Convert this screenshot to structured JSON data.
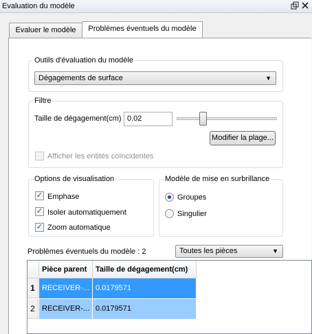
{
  "window": {
    "title": "Evaluation du modèle",
    "icons": [
      "restore-icon",
      "close-icon"
    ]
  },
  "tabs": [
    {
      "label": "Evaluer le modèle",
      "active": false
    },
    {
      "label": "Problèmes éventuels du modèle",
      "active": true
    }
  ],
  "tools": {
    "group_title": "Outils d'évaluation du modèle",
    "selected": "Dégagements de surface"
  },
  "filter": {
    "group_title": "Filtre",
    "size_label": "Taille de dégagement(cm)",
    "size_value": "0.02",
    "modify_button": "Modifier la plage...",
    "coincident_label": "Afficher les entités coïncidentes",
    "coincident_checked": false
  },
  "display": {
    "group_title": "Options de visualisation",
    "options": [
      {
        "label": "Emphase",
        "checked": true
      },
      {
        "label": "Isoler automatiquement",
        "checked": true
      },
      {
        "label": "Zoom automatique",
        "checked": true
      }
    ]
  },
  "highlight": {
    "group_title": "Modèle de mise en surbrillance",
    "options": [
      {
        "label": "Groupes",
        "selected": true
      },
      {
        "label": "Singulier",
        "selected": false
      }
    ]
  },
  "problems": {
    "count_label": "Problèmes éventuels du modèle : 2",
    "scope_selected": "Toutes les pièces",
    "columns": [
      "Pièce parent",
      "Taille de dégagement(cm)"
    ],
    "rows": [
      {
        "index": "1",
        "parent": "RECEIVER-...",
        "size": "0.0179571"
      },
      {
        "index": "2",
        "parent": "RECEIVER-...",
        "size": "0.0179571"
      }
    ]
  },
  "colors": {
    "selected_row": "#3399ff",
    "secondary_row": "#99ccff"
  }
}
